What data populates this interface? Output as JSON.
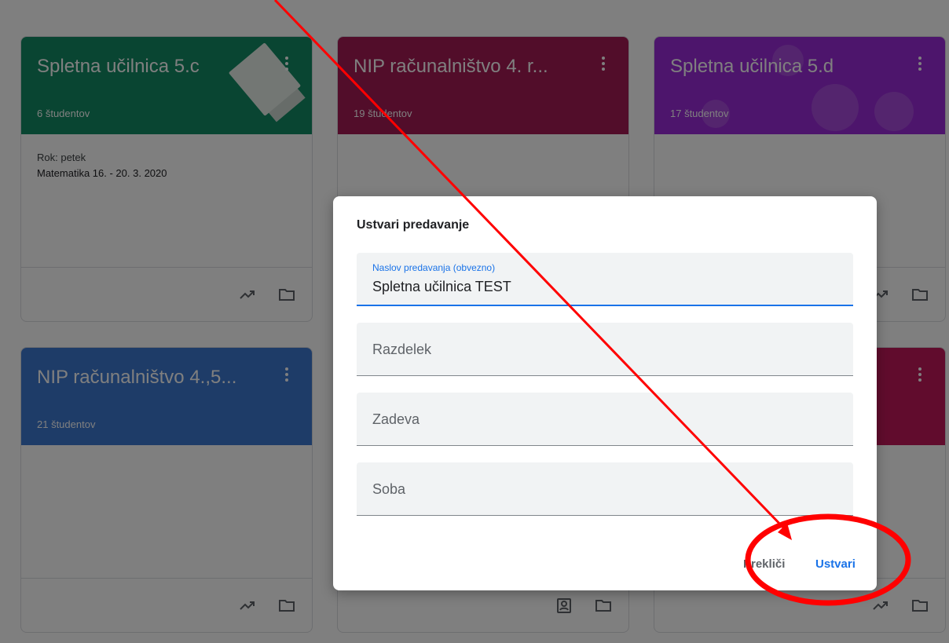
{
  "cards": [
    {
      "title": "Spletna učilnica 5.c",
      "subtitle": "6 študentov",
      "color": "#128a64",
      "body_line1": "Rok: petek",
      "body_line2": "Matematika 16. - 20. 3. 2020"
    },
    {
      "title": "NIP računalništvo 4. r...",
      "subtitle": "19 študentov",
      "color": "#a51a55"
    },
    {
      "title": "Spletna učilnica 5.d",
      "subtitle": "17 študentov",
      "color": "#9a2bd8"
    },
    {
      "title": "NIP računalništvo 4.,5...",
      "subtitle": "21 študentov",
      "color": "#3c78d0"
    },
    {
      "color": "#c2185b"
    }
  ],
  "dialog": {
    "title": "Ustvari predavanje",
    "fields": [
      {
        "label": "Naslov predavanja (obvezno)",
        "value": "Spletna učilnica TEST"
      },
      {
        "placeholder": "Razdelek"
      },
      {
        "placeholder": "Zadeva"
      },
      {
        "placeholder": "Soba"
      }
    ],
    "cancel_label": "Prekliči",
    "create_label": "Ustvari"
  },
  "colors": {
    "accent": "#1a73e8",
    "annotation": "#ff0000"
  },
  "icons": [
    "more-vert-icon",
    "trend-icon",
    "folder-icon",
    "assignment-ind-icon"
  ]
}
